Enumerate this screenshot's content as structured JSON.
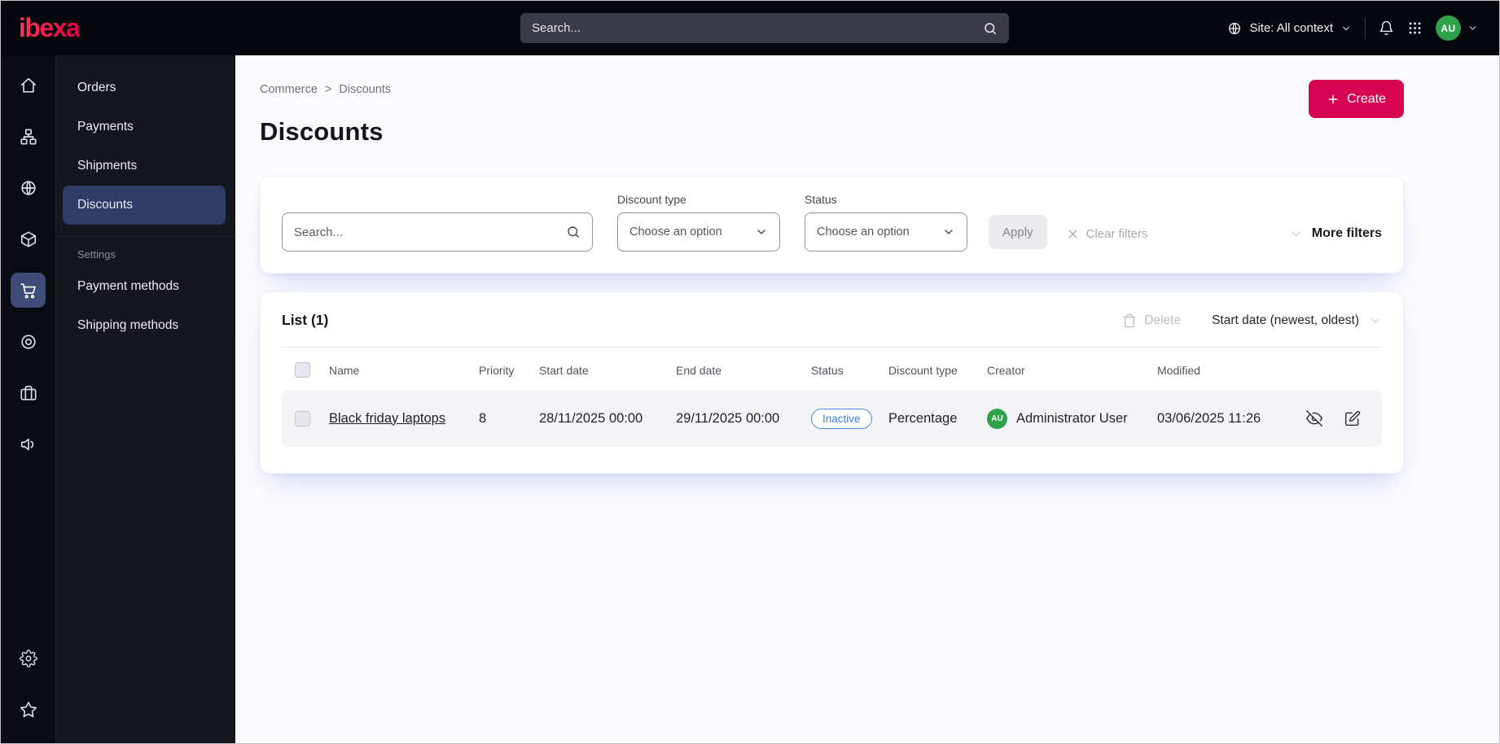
{
  "colors": {
    "brand_primary": "#d70551",
    "topbar_bg": "#06060d",
    "sidebar_bg": "#16161e",
    "active_nav_bg": "#2e3c66",
    "badge_inactive_blue": "#3c7fd6",
    "avatar_green": "#2fa14b"
  },
  "icons": {
    "search": "magnifier",
    "globe": "globe",
    "chevron_down": "chevron-down",
    "bell": "bell",
    "app_grid": "3x3-dot-grid",
    "home": "house",
    "content_tree": "sitemap",
    "site": "globe",
    "product_catalog": "cube",
    "commerce": "shopping-cart",
    "personalization": "target",
    "corporate": "briefcase",
    "marketing": "megaphone-speaker",
    "settings": "gear",
    "bookmarks": "star",
    "plus": "plus",
    "clear": "x-cross",
    "delete": "trash-can",
    "deactivate": "eye-off",
    "edit": "pencil-square"
  },
  "topbar": {
    "logo": "ibexa",
    "search_placeholder": "Search...",
    "site_context": "Site: All context",
    "avatar_initials": "AU"
  },
  "sidebar": {
    "menu_items": [
      {
        "label": "Orders"
      },
      {
        "label": "Payments"
      },
      {
        "label": "Shipments"
      },
      {
        "label": "Discounts"
      }
    ],
    "settings_label": "Settings",
    "settings_items": [
      {
        "label": "Payment methods"
      },
      {
        "label": "Shipping methods"
      }
    ]
  },
  "main": {
    "breadcrumb": {
      "parent": "Commerce",
      "separator": ">",
      "current": "Discounts"
    },
    "create_label": "Create",
    "title": "Discounts",
    "filters": {
      "search_placeholder": "Search...",
      "discount_type_label": "Discount type",
      "discount_type_value": "Choose an option",
      "status_label": "Status",
      "status_value": "Choose an option",
      "apply_label": "Apply",
      "clear_label": "Clear filters",
      "more_filters_label": "More filters"
    },
    "list": {
      "title": "List (1)",
      "delete_label": "Delete",
      "sort_label": "Start date (newest, oldest)",
      "columns": [
        "Name",
        "Priority",
        "Start date",
        "End date",
        "Status",
        "Discount type",
        "Creator",
        "Modified"
      ],
      "rows": [
        {
          "name": "Black friday laptops",
          "priority": "8",
          "start_date": "28/11/2025 00:00",
          "end_date": "29/11/2025 00:00",
          "status": "Inactive",
          "discount_type": "Percentage",
          "creator": "Administrator User",
          "creator_initials": "AU",
          "modified": "03/06/2025 11:26"
        }
      ]
    }
  }
}
